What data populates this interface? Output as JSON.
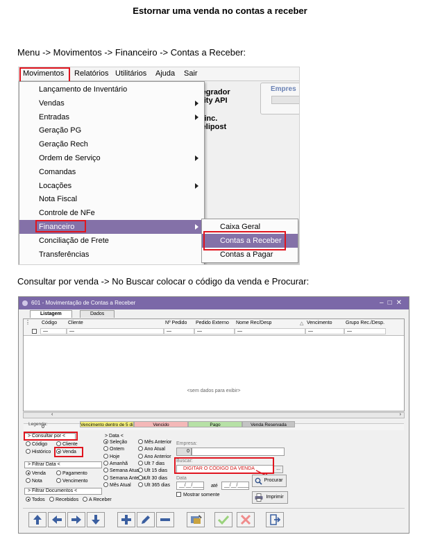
{
  "doc_title": "Estornar uma venda no contas a receber",
  "instruction1": "Menu -> Movimentos -> Financeiro -> Contas a Receber:",
  "instruction2": "Consultar por venda -> No Buscar colocar o código da venda e Procurar:",
  "shot1": {
    "menubar": [
      "Movimentos",
      "Relatórios",
      "Utilitários",
      "Ajuda",
      "Sair"
    ],
    "background_text": {
      "line1": "tegrador",
      "line2": "nity API",
      "line3": "Sinc.",
      "line4": "telipost",
      "empresa": "Empres"
    },
    "dropdown_items": [
      {
        "label": "Lançamento de Inventário",
        "submenu": false
      },
      {
        "label": "Vendas",
        "submenu": true
      },
      {
        "label": "Entradas",
        "submenu": true
      },
      {
        "label": "Geração PG",
        "submenu": false
      },
      {
        "label": "Geração Rech",
        "submenu": false
      },
      {
        "label": "Ordem de Serviço",
        "submenu": true
      },
      {
        "label": "Comandas",
        "submenu": false
      },
      {
        "label": "Locações",
        "submenu": true
      },
      {
        "label": "Nota Fiscal",
        "submenu": false
      },
      {
        "label": "Controle de NFe",
        "submenu": false
      },
      {
        "label": "Financeiro",
        "submenu": true
      },
      {
        "label": "Conciliação de Frete",
        "submenu": false
      },
      {
        "label": "Transferências",
        "submenu": false
      }
    ],
    "submenu_items": [
      "Caixa Geral",
      "Contas a Receber",
      "Contas a Pagar"
    ]
  },
  "shot2": {
    "window_title": "601 - Movimentação de Contas a Receber",
    "tabs": [
      "Listagem",
      "Dados"
    ],
    "columns": [
      "Código",
      "Cliente",
      "Nº Pedido",
      "Pedido Externo",
      "Nome Rec/Desp",
      "Vencimento",
      "Grupo Rec./Desp."
    ],
    "filter_placeholder": "—",
    "empty_message": "<sem dados para exibir>",
    "footer_count": "0",
    "legend_label": "Legenda:",
    "legend_items": [
      {
        "label": "Vencimento dentro de 5 dias",
        "color": "#f5f07a"
      },
      {
        "label": "Vencido",
        "color": "#f4b8b8"
      },
      {
        "label": "Pago",
        "color": "#b7e1a6"
      },
      {
        "label": "Venda Reservada",
        "color": "#c4c4c4"
      }
    ],
    "consultar": {
      "header": "> Consultar por <",
      "options": [
        "Código",
        "Cliente",
        "Histórico",
        "Venda"
      ],
      "selected": "Venda"
    },
    "filtrar_data": {
      "header": "> Filtrar Data <",
      "options": [
        "Venda",
        "Pagamento",
        "Nota",
        "Vencimento"
      ],
      "selected": "Venda"
    },
    "filtrar_documentos": {
      "header": "> Filtrar Documentos <",
      "options": [
        "Todos",
        "Recebidos",
        "A Receber"
      ],
      "selected": "Todos"
    },
    "data_group": {
      "header": "> Data <",
      "col1": [
        "Seleção",
        "Ontem",
        "Hoje",
        "Amanhã",
        "Semana Atual",
        "Semana Anterior",
        "Mês Atual"
      ],
      "col2": [
        "Mês Anterior",
        "Ano Atual",
        "Ano Anterior",
        "Ult 7 dias",
        "Ult 15 dias",
        "Ult 30 dias",
        "Ult 365 dias"
      ],
      "selected": "Seleção"
    },
    "empresa_label": "Empresa:",
    "empresa_code": "0",
    "buscar_label": "Buscar:",
    "buscar_value": "DIGITAR O CÓDIGO DA VENDA",
    "buscar_btn": "...",
    "procurar_btn": "Procurar",
    "data_label": "Data",
    "date_from": "__/__/____",
    "ate_label": "até",
    "date_to": "__/__/____",
    "mostrar_somente": "Mostrar somente",
    "imprimir_btn": "Imprimir",
    "toolbar_icons": [
      "arrow-up-icon",
      "arrow-left-icon",
      "arrow-right-icon",
      "arrow-down-icon",
      "plus-icon",
      "pencil-icon",
      "minus-icon",
      "tools-icon",
      "check-icon",
      "x-icon",
      "exit-icon"
    ]
  },
  "colors": {
    "highlight_red": "#e0141e",
    "menu_active": "#8471a8",
    "title_bar": "#7b68a8"
  }
}
